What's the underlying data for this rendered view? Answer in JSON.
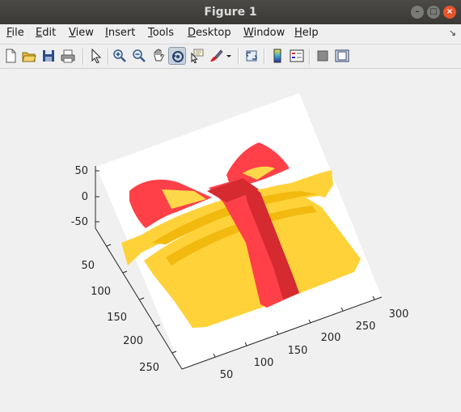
{
  "window": {
    "title": "Figure 1"
  },
  "window_controls": {
    "minimize": "–",
    "maximize": "□",
    "close": "×"
  },
  "menu": {
    "items": [
      {
        "mnemonic": "F",
        "rest": "ile"
      },
      {
        "mnemonic": "E",
        "rest": "dit"
      },
      {
        "mnemonic": "V",
        "rest": "iew"
      },
      {
        "mnemonic": "I",
        "rest": "nsert"
      },
      {
        "mnemonic": "T",
        "rest": "ools"
      },
      {
        "mnemonic": "D",
        "rest": "esktop"
      },
      {
        "mnemonic": "W",
        "rest": "indow"
      },
      {
        "mnemonic": "H",
        "rest": "elp"
      }
    ],
    "dock_glyph": "↘"
  },
  "toolbar": {
    "buttons": [
      "new-figure-icon",
      "open-file-icon",
      "save-icon",
      "print-icon",
      "edit-plot-arrow-icon",
      "zoom-in-icon",
      "zoom-out-icon",
      "pan-hand-icon",
      "rotate-3d-icon",
      "data-cursor-icon",
      "brush-icon",
      "brush-dropdown-icon",
      "link-plot-icon",
      "colorbar-icon",
      "legend-icon",
      "hide-plot-tools-icon",
      "show-plot-tools-icon"
    ],
    "active": "rotate-3d-icon"
  },
  "axes": {
    "z_ticks": [
      "50",
      "0",
      "-50"
    ],
    "y_ticks": [
      "50",
      "100",
      "150",
      "200",
      "250"
    ],
    "x_ticks": [
      "50",
      "100",
      "150",
      "200",
      "250",
      "300"
    ]
  },
  "colors": {
    "gift_yellow": "#ffd23a",
    "gift_yellow_dark": "#f2b90f",
    "ribbon_red": "#ff4048",
    "ribbon_red_dark": "#d42a30",
    "axes_bg": "#ffffff",
    "figure_bg": "#f0f0f0"
  }
}
